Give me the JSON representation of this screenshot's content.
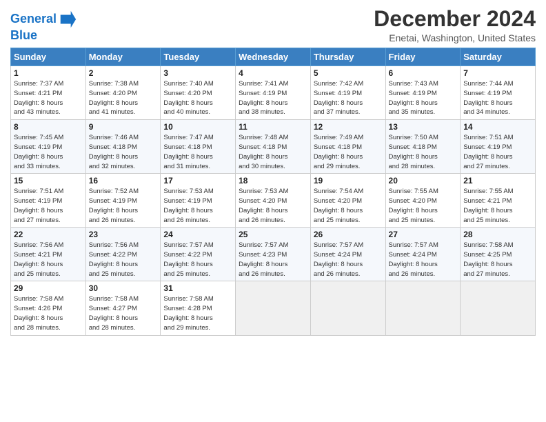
{
  "logo": {
    "line1": "General",
    "line2": "Blue"
  },
  "title": "December 2024",
  "location": "Enetai, Washington, United States",
  "days_of_week": [
    "Sunday",
    "Monday",
    "Tuesday",
    "Wednesday",
    "Thursday",
    "Friday",
    "Saturday"
  ],
  "weeks": [
    [
      {
        "day": "1",
        "lines": [
          "Sunrise: 7:37 AM",
          "Sunset: 4:21 PM",
          "Daylight: 8 hours",
          "and 43 minutes."
        ]
      },
      {
        "day": "2",
        "lines": [
          "Sunrise: 7:38 AM",
          "Sunset: 4:20 PM",
          "Daylight: 8 hours",
          "and 41 minutes."
        ]
      },
      {
        "day": "3",
        "lines": [
          "Sunrise: 7:40 AM",
          "Sunset: 4:20 PM",
          "Daylight: 8 hours",
          "and 40 minutes."
        ]
      },
      {
        "day": "4",
        "lines": [
          "Sunrise: 7:41 AM",
          "Sunset: 4:19 PM",
          "Daylight: 8 hours",
          "and 38 minutes."
        ]
      },
      {
        "day": "5",
        "lines": [
          "Sunrise: 7:42 AM",
          "Sunset: 4:19 PM",
          "Daylight: 8 hours",
          "and 37 minutes."
        ]
      },
      {
        "day": "6",
        "lines": [
          "Sunrise: 7:43 AM",
          "Sunset: 4:19 PM",
          "Daylight: 8 hours",
          "and 35 minutes."
        ]
      },
      {
        "day": "7",
        "lines": [
          "Sunrise: 7:44 AM",
          "Sunset: 4:19 PM",
          "Daylight: 8 hours",
          "and 34 minutes."
        ]
      }
    ],
    [
      {
        "day": "8",
        "lines": [
          "Sunrise: 7:45 AM",
          "Sunset: 4:19 PM",
          "Daylight: 8 hours",
          "and 33 minutes."
        ]
      },
      {
        "day": "9",
        "lines": [
          "Sunrise: 7:46 AM",
          "Sunset: 4:18 PM",
          "Daylight: 8 hours",
          "and 32 minutes."
        ]
      },
      {
        "day": "10",
        "lines": [
          "Sunrise: 7:47 AM",
          "Sunset: 4:18 PM",
          "Daylight: 8 hours",
          "and 31 minutes."
        ]
      },
      {
        "day": "11",
        "lines": [
          "Sunrise: 7:48 AM",
          "Sunset: 4:18 PM",
          "Daylight: 8 hours",
          "and 30 minutes."
        ]
      },
      {
        "day": "12",
        "lines": [
          "Sunrise: 7:49 AM",
          "Sunset: 4:18 PM",
          "Daylight: 8 hours",
          "and 29 minutes."
        ]
      },
      {
        "day": "13",
        "lines": [
          "Sunrise: 7:50 AM",
          "Sunset: 4:18 PM",
          "Daylight: 8 hours",
          "and 28 minutes."
        ]
      },
      {
        "day": "14",
        "lines": [
          "Sunrise: 7:51 AM",
          "Sunset: 4:19 PM",
          "Daylight: 8 hours",
          "and 27 minutes."
        ]
      }
    ],
    [
      {
        "day": "15",
        "lines": [
          "Sunrise: 7:51 AM",
          "Sunset: 4:19 PM",
          "Daylight: 8 hours",
          "and 27 minutes."
        ]
      },
      {
        "day": "16",
        "lines": [
          "Sunrise: 7:52 AM",
          "Sunset: 4:19 PM",
          "Daylight: 8 hours",
          "and 26 minutes."
        ]
      },
      {
        "day": "17",
        "lines": [
          "Sunrise: 7:53 AM",
          "Sunset: 4:19 PM",
          "Daylight: 8 hours",
          "and 26 minutes."
        ]
      },
      {
        "day": "18",
        "lines": [
          "Sunrise: 7:53 AM",
          "Sunset: 4:20 PM",
          "Daylight: 8 hours",
          "and 26 minutes."
        ]
      },
      {
        "day": "19",
        "lines": [
          "Sunrise: 7:54 AM",
          "Sunset: 4:20 PM",
          "Daylight: 8 hours",
          "and 25 minutes."
        ]
      },
      {
        "day": "20",
        "lines": [
          "Sunrise: 7:55 AM",
          "Sunset: 4:20 PM",
          "Daylight: 8 hours",
          "and 25 minutes."
        ]
      },
      {
        "day": "21",
        "lines": [
          "Sunrise: 7:55 AM",
          "Sunset: 4:21 PM",
          "Daylight: 8 hours",
          "and 25 minutes."
        ]
      }
    ],
    [
      {
        "day": "22",
        "lines": [
          "Sunrise: 7:56 AM",
          "Sunset: 4:21 PM",
          "Daylight: 8 hours",
          "and 25 minutes."
        ]
      },
      {
        "day": "23",
        "lines": [
          "Sunrise: 7:56 AM",
          "Sunset: 4:22 PM",
          "Daylight: 8 hours",
          "and 25 minutes."
        ]
      },
      {
        "day": "24",
        "lines": [
          "Sunrise: 7:57 AM",
          "Sunset: 4:22 PM",
          "Daylight: 8 hours",
          "and 25 minutes."
        ]
      },
      {
        "day": "25",
        "lines": [
          "Sunrise: 7:57 AM",
          "Sunset: 4:23 PM",
          "Daylight: 8 hours",
          "and 26 minutes."
        ]
      },
      {
        "day": "26",
        "lines": [
          "Sunrise: 7:57 AM",
          "Sunset: 4:24 PM",
          "Daylight: 8 hours",
          "and 26 minutes."
        ]
      },
      {
        "day": "27",
        "lines": [
          "Sunrise: 7:57 AM",
          "Sunset: 4:24 PM",
          "Daylight: 8 hours",
          "and 26 minutes."
        ]
      },
      {
        "day": "28",
        "lines": [
          "Sunrise: 7:58 AM",
          "Sunset: 4:25 PM",
          "Daylight: 8 hours",
          "and 27 minutes."
        ]
      }
    ],
    [
      {
        "day": "29",
        "lines": [
          "Sunrise: 7:58 AM",
          "Sunset: 4:26 PM",
          "Daylight: 8 hours",
          "and 28 minutes."
        ]
      },
      {
        "day": "30",
        "lines": [
          "Sunrise: 7:58 AM",
          "Sunset: 4:27 PM",
          "Daylight: 8 hours",
          "and 28 minutes."
        ]
      },
      {
        "day": "31",
        "lines": [
          "Sunrise: 7:58 AM",
          "Sunset: 4:28 PM",
          "Daylight: 8 hours",
          "and 29 minutes."
        ]
      },
      null,
      null,
      null,
      null
    ]
  ]
}
